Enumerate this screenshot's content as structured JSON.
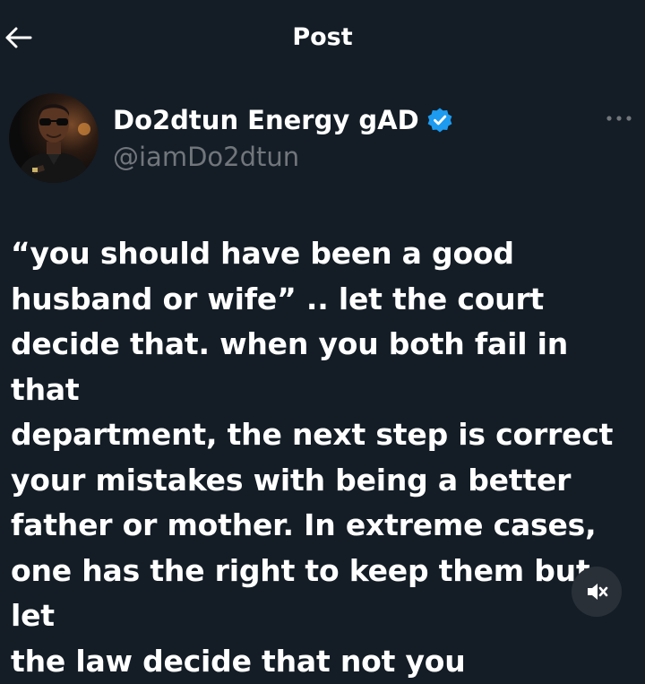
{
  "header": {
    "title": "Post",
    "back_icon": "arrow-left-icon"
  },
  "author": {
    "display_name": "Do2dtun Energy gAD",
    "handle": "@iamDo2dtun",
    "verified": true,
    "verified_color": "#1d9bf0",
    "more_icon": "more-horizontal-icon"
  },
  "post": {
    "text": "“you should have been a good\nhusband or wife” .. let the court\ndecide that. when you both fail in that\ndepartment, the next step is correct\nyour mistakes with being a better\nfather or mother. In extreme cases,\none has the right to keep them but let\nthe law decide that not you"
  },
  "media": {
    "mute_icon": "speaker-muted-icon"
  },
  "colors": {
    "background": "#141d26",
    "text_primary": "#ffffff",
    "text_secondary": "#71767b",
    "accent": "#1d9bf0"
  }
}
